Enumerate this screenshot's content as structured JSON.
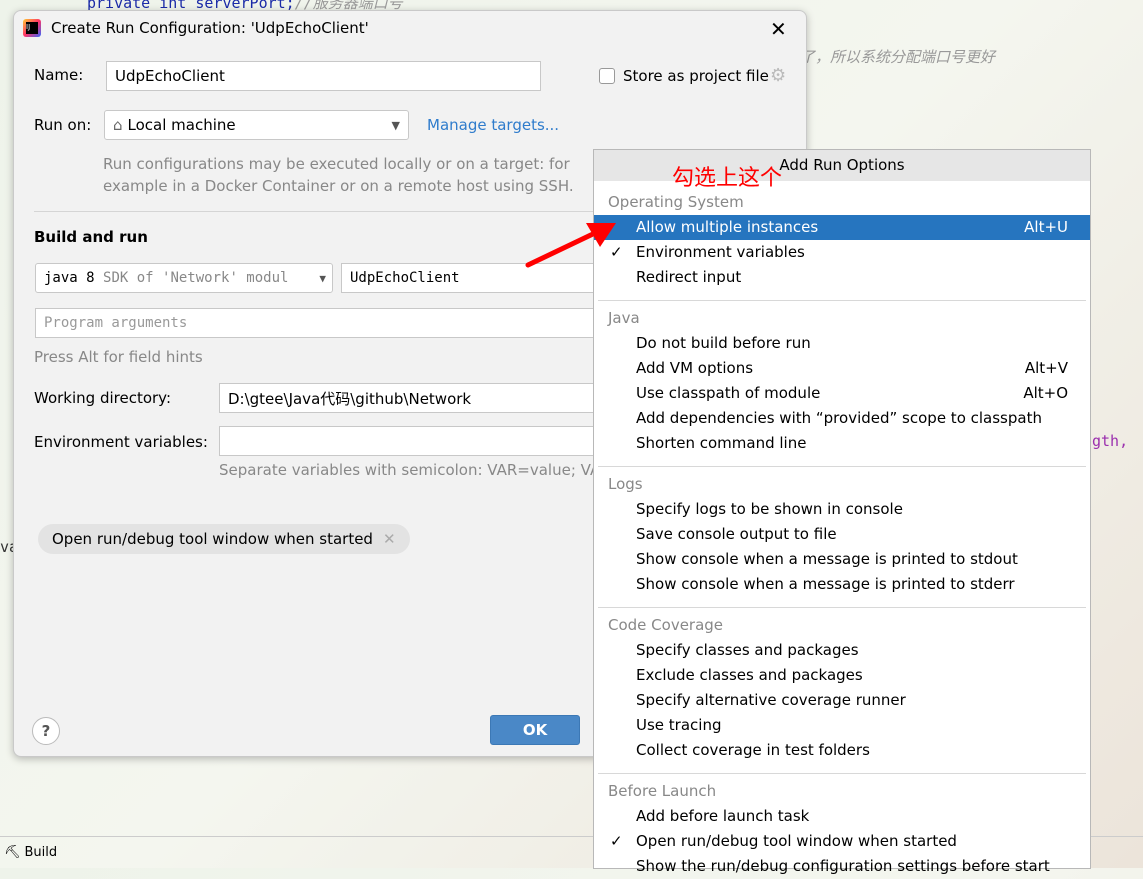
{
  "background": {
    "code_line1": "private int serverPort;",
    "comment1": "//服务器端口号",
    "comment2": "了，所以系统分配端口号更好",
    "code_frag": "gth,",
    "code_frag2": "va",
    "status_build": "Build"
  },
  "dialog": {
    "title": "Create Run Configuration: 'UdpEchoClient'",
    "name_label": "Name:",
    "name_value": "UdpEchoClient",
    "store_label": "Store as project file",
    "store_checked": false,
    "run_on_label": "Run on:",
    "run_on_value": "Local machine",
    "manage_targets": "Manage targets...",
    "run_hint1": "Run configurations may be executed locally or on a target: for",
    "run_hint2": "example in a Docker Container or on a remote host using SSH.",
    "build_and_run": "Build and run",
    "sdk_main": "java 8",
    "sdk_rest": "SDK of 'Network' modul",
    "main_class": "UdpEchoClient",
    "program_args_placeholder": "Program arguments",
    "alt_hint": "Press Alt for field hints",
    "working_dir_label": "Working directory:",
    "working_dir_value": "D:\\gtee\\Java代码\\github\\Network",
    "env_label": "Environment variables:",
    "env_value": "",
    "env_hint": "Separate variables with semicolon: VAR=value; VAR",
    "chip": "Open run/debug tool window when started",
    "ok": "OK",
    "help": "?"
  },
  "annotation": {
    "text": "勾选上这个",
    "color": "#ff0000"
  },
  "popup": {
    "title": "Add Run Options",
    "sections": [
      {
        "name": "Operating System",
        "items": [
          {
            "label": "Allow multiple instances",
            "shortcut": "Alt+U",
            "selected": true
          },
          {
            "label": "Environment variables",
            "checked": true
          },
          {
            "label": "Redirect input"
          }
        ]
      },
      {
        "name": "Java",
        "items": [
          {
            "label": "Do not build before run"
          },
          {
            "label": "Add VM options",
            "shortcut": "Alt+V"
          },
          {
            "label": "Use classpath of module",
            "shortcut": "Alt+O"
          },
          {
            "label": "Add dependencies with “provided” scope to classpath"
          },
          {
            "label": "Shorten command line"
          }
        ]
      },
      {
        "name": "Logs",
        "items": [
          {
            "label": "Specify logs to be shown in console"
          },
          {
            "label": "Save console output to file"
          },
          {
            "label": "Show console when a message is printed to stdout"
          },
          {
            "label": "Show console when a message is printed to stderr"
          }
        ]
      },
      {
        "name": "Code Coverage",
        "items": [
          {
            "label": "Specify classes and packages"
          },
          {
            "label": "Exclude classes and packages"
          },
          {
            "label": "Specify alternative coverage runner"
          },
          {
            "label": "Use tracing"
          },
          {
            "label": "Collect coverage in test folders"
          }
        ]
      },
      {
        "name": "Before Launch",
        "items": [
          {
            "label": "Add before launch task"
          },
          {
            "label": "Open run/debug tool window when started",
            "checked": true
          },
          {
            "label": "Show the run/debug configuration settings before start"
          }
        ]
      }
    ]
  },
  "colors": {
    "accent": "#2675bf",
    "link": "#2f7ccc",
    "ok_button": "#4a88c7"
  }
}
